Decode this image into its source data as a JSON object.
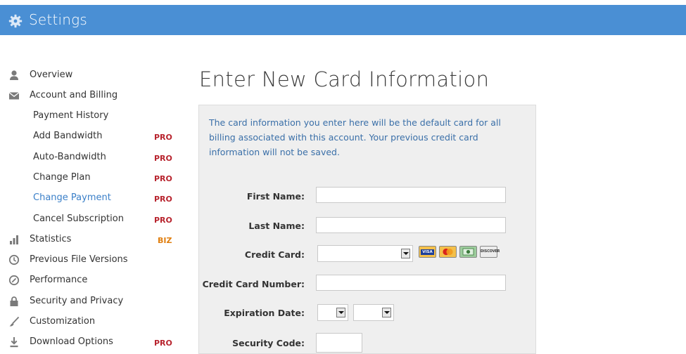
{
  "header": {
    "title": "Settings",
    "icon": "gear-icon"
  },
  "sidebar": {
    "items": [
      {
        "label": "Overview",
        "icon": "user-icon",
        "badge": ""
      },
      {
        "label": "Account and Billing",
        "icon": "envelope-icon",
        "badge": ""
      },
      {
        "label": "Payment History",
        "badge": ""
      },
      {
        "label": "Add Bandwidth",
        "badge": "PRO"
      },
      {
        "label": "Auto-Bandwidth",
        "badge": "PRO"
      },
      {
        "label": "Change Plan",
        "badge": "PRO"
      },
      {
        "label": "Change Payment",
        "badge": "PRO"
      },
      {
        "label": "Cancel Subscription",
        "badge": "PRO"
      },
      {
        "label": "Statistics",
        "icon": "bar-chart-icon",
        "badge": "BIZ"
      },
      {
        "label": "Previous File Versions",
        "icon": "clock-icon",
        "badge": ""
      },
      {
        "label": "Performance",
        "icon": "gauge-icon",
        "badge": ""
      },
      {
        "label": "Security and Privacy",
        "icon": "lock-icon",
        "badge": ""
      },
      {
        "label": "Customization",
        "icon": "brush-icon",
        "badge": ""
      },
      {
        "label": "Download Options",
        "icon": "download-icon",
        "badge": "PRO"
      }
    ]
  },
  "main": {
    "heading": "Enter New Card Information",
    "notice": "The card information you enter here will be the default card for all billing associated with this account. Your previous credit card information will not be saved.",
    "form": {
      "first_name_label": "First Name:",
      "last_name_label": "Last Name:",
      "credit_card_label": "Credit Card:",
      "card_number_label": "Credit Card Number:",
      "expiration_label": "Expiration Date:",
      "security_code_label": "Security Code:",
      "first_name_value": "",
      "last_name_value": "",
      "card_number_value": "",
      "security_code_value": "",
      "credit_card_selected": "",
      "exp_month_selected": "",
      "exp_year_selected": ""
    },
    "card_logos": [
      "VISA",
      "mastercard",
      "amex",
      "DISCOVER"
    ]
  },
  "colors": {
    "header_bg": "#4a8fd4",
    "pro_badge": "#b8242e",
    "biz_badge": "#e07f10",
    "active_link": "#3a7fc8",
    "notice_text": "#3a6fa8"
  }
}
